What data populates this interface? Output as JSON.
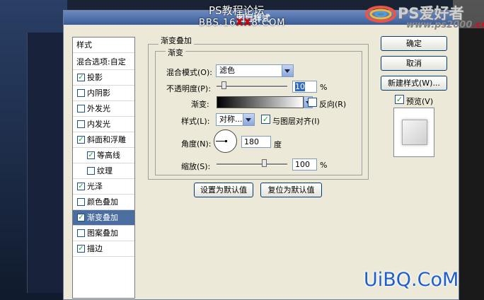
{
  "overlay": {
    "line1": "PS教程论坛",
    "line2_a": "BBS.16",
    "line2_b": "XX",
    "line2_c": "8.COM"
  },
  "logo": {
    "name": "PS爱好者",
    "url_a": "www.ps2000",
    "url_b": ".cn"
  },
  "window": {
    "title": "图层样式"
  },
  "left_panel": {
    "items": [
      {
        "label": "样式",
        "checked": null,
        "selected": false,
        "indent": 0
      },
      {
        "label": "混合选项:自定",
        "checked": null,
        "selected": false,
        "indent": 0
      },
      {
        "label": "投影",
        "checked": true,
        "selected": false,
        "indent": 0
      },
      {
        "label": "内阴影",
        "checked": false,
        "selected": false,
        "indent": 0
      },
      {
        "label": "外发光",
        "checked": false,
        "selected": false,
        "indent": 0
      },
      {
        "label": "内发光",
        "checked": false,
        "selected": false,
        "indent": 0
      },
      {
        "label": "斜面和浮雕",
        "checked": true,
        "selected": false,
        "indent": 0
      },
      {
        "label": "等高线",
        "checked": true,
        "selected": false,
        "indent": 1
      },
      {
        "label": "纹理",
        "checked": false,
        "selected": false,
        "indent": 1
      },
      {
        "label": "光泽",
        "checked": true,
        "selected": false,
        "indent": 0
      },
      {
        "label": "颜色叠加",
        "checked": false,
        "selected": false,
        "indent": 0
      },
      {
        "label": "渐变叠加",
        "checked": true,
        "selected": true,
        "indent": 0
      },
      {
        "label": "图案叠加",
        "checked": false,
        "selected": false,
        "indent": 0
      },
      {
        "label": "描边",
        "checked": true,
        "selected": false,
        "indent": 0
      }
    ]
  },
  "gradient_overlay": {
    "group_title": "渐变叠加",
    "subgroup_title": "渐变",
    "blend_mode_label": "混合模式(O):",
    "blend_mode_value": "滤色",
    "opacity_label": "不透明度(P):",
    "opacity_value": "10",
    "opacity_fraction": 0.1,
    "percent_sign": "%",
    "gradient_label": "渐变:",
    "reverse_label": "反向(R)",
    "reverse_checked": false,
    "style_label": "样式(L):",
    "style_value": "对称...",
    "align_label": "与图层对齐(I)",
    "align_checked": true,
    "angle_label": "角度(N):",
    "angle_value": "180",
    "degree_sign": "度",
    "scale_label": "缩放(S):",
    "scale_value": "100",
    "scale_fraction": 0.67,
    "set_default_button": "设置为默认值",
    "reset_default_button": "复位为默认值"
  },
  "right_buttons": {
    "ok": "确定",
    "cancel": "取消",
    "new_style": "新建样式(W)...",
    "preview_label": "预览(V)",
    "preview_checked": true
  },
  "watermark": "UiBQ.CoM",
  "check_glyph": "✓"
}
